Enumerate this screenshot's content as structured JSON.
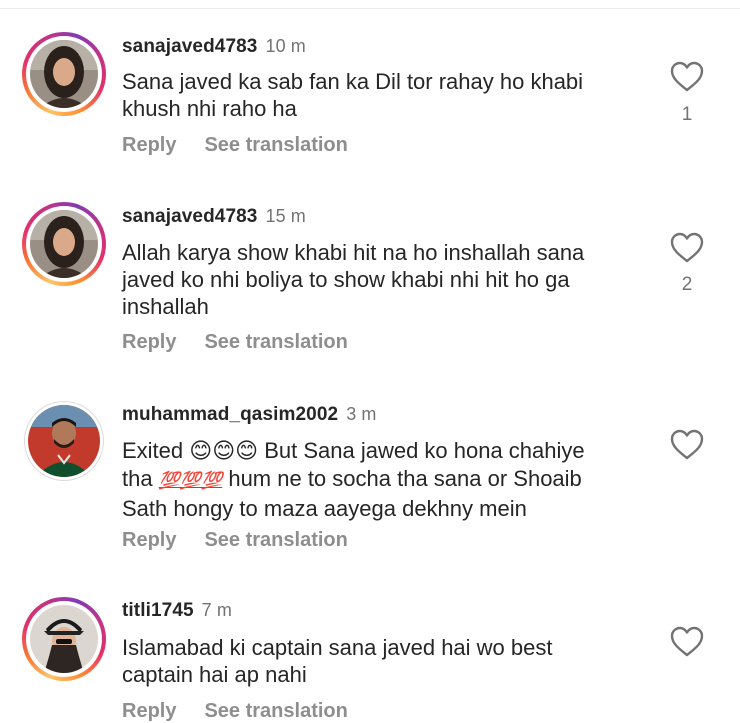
{
  "comments": [
    {
      "username": "sanajaved4783",
      "time": "10 m",
      "text_lines": [
        "Sana javed ka sab fan ka Dil tor rahay ho khabi",
        "khush nhi raho ha"
      ],
      "likes": "1",
      "reply_label": "Reply",
      "translate_label": "See translation",
      "story_ring": true
    },
    {
      "username": "sanajaved4783",
      "time": "15 m",
      "text_lines": [
        "Allah karya show khabi hit na ho inshallah  sana",
        "javed ko nhi boliya to show khabi nhi hit ho ga",
        "inshallah"
      ],
      "likes": "2",
      "reply_label": "Reply",
      "translate_label": "See translation",
      "story_ring": true
    },
    {
      "username": "muhammad_qasim2002",
      "time": "3 m",
      "text_parts": {
        "start": "Exited ",
        "emoji_smile": "😊😊😊",
        "mid": " But Sana jawed ko hona chahiye",
        "line2_start": "tha ",
        "emoji_hundred": "💯💯💯",
        "line2_end": " hum ne to socha tha sana or Shoaib",
        "line3": "Sath hongy to maza aayega dekhny mein"
      },
      "reply_label": "Reply",
      "translate_label": "See translation",
      "story_ring": false
    },
    {
      "username": "titli1745",
      "time": "7 m",
      "text_lines": [
        "Islamabad ki captain sana javed hai wo best",
        "captain hai ap nahi"
      ],
      "reply_label": "Reply",
      "translate_label": "See translation",
      "story_ring": true
    }
  ],
  "icons": {
    "like": "heart-outline-icon"
  },
  "colors": {
    "text": "#262626",
    "secondary": "#737373",
    "action": "#8e8e8e",
    "story_ring_start": "#fdc468",
    "story_ring_end": "#c13584"
  }
}
